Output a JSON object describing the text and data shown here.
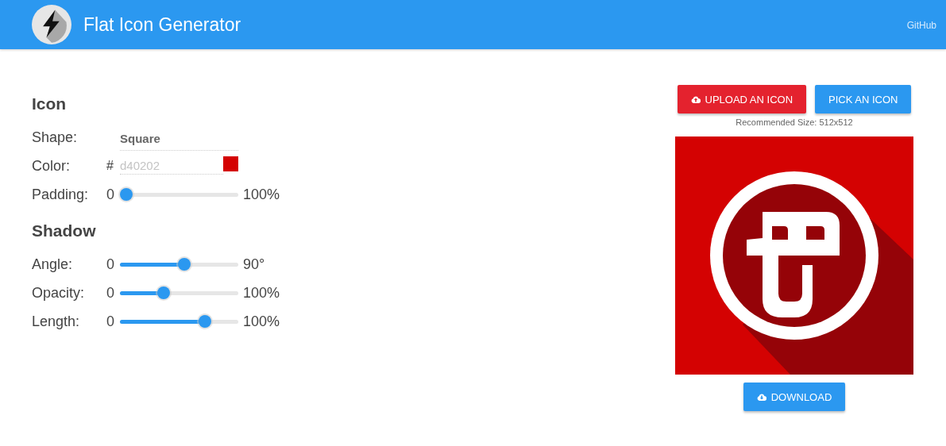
{
  "header": {
    "title": "Flat Icon Generator",
    "link": "GitHub"
  },
  "icon_section": {
    "heading": "Icon",
    "shape": {
      "label": "Shape:",
      "value": "Square"
    },
    "color": {
      "label": "Color:",
      "prefix": "#",
      "value": "d40202"
    },
    "padding": {
      "label": "Padding:",
      "min": "0",
      "max": "100%",
      "level": 0
    }
  },
  "shadow_section": {
    "heading": "Shadow",
    "sliders": [
      {
        "label": "Angle:",
        "min": "0",
        "max": "90°",
        "level": 0.52
      },
      {
        "label": "Opacity:",
        "min": "0",
        "max": "100%",
        "level": 0.33
      },
      {
        "label": "Length:",
        "min": "0",
        "max": "100%",
        "level": 0.7
      }
    ]
  },
  "upload_button": "UPLOAD AN ICON",
  "pick_button": "PICK AN ICON",
  "recommended": "Recommended Size: 512x512",
  "download_button": "DOWNLOAD"
}
